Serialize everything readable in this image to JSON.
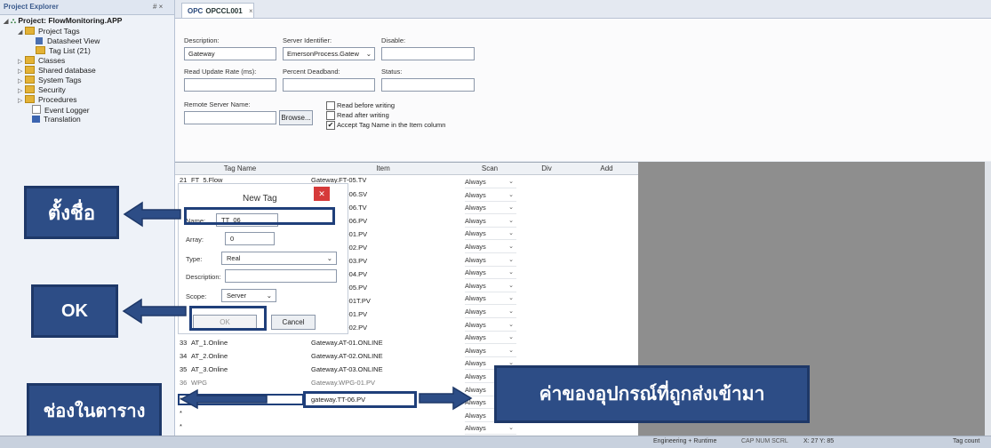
{
  "explorer": {
    "header": "Project Explorer",
    "header_controls": "# ×",
    "project": "Project: FlowMonitoring.APP",
    "items": [
      {
        "label": "Project Tags"
      },
      {
        "label": "Datasheet View"
      },
      {
        "label": "Tag List (21)"
      },
      {
        "label": "Classes"
      },
      {
        "label": "Shared database"
      },
      {
        "label": "System Tags"
      },
      {
        "label": "Security"
      },
      {
        "label": "Procedures"
      },
      {
        "label": "Event Logger"
      },
      {
        "label": "Translation"
      }
    ]
  },
  "tab": {
    "icon": "OPC",
    "label": "OPCCL001",
    "close": "×"
  },
  "props": {
    "description_label": "Description:",
    "description_value": "Gateway",
    "server_label": "Server Identifier:",
    "server_value": "EmersonProcess.Gatew",
    "disable_label": "Disable:",
    "read_rate_label": "Read Update Rate (ms):",
    "deadband_label": "Percent Deadband:",
    "status_label": "Status:",
    "remote_label": "Remote Server Name:",
    "browse_label": "Browse...",
    "read_before": "Read before writing",
    "read_after": "Read after writing",
    "accept_tag": "Accept Tag Name in the Item column"
  },
  "grid": {
    "headers": [
      "Tag Name",
      "Item",
      "Scan",
      "Div",
      "Add"
    ],
    "first_row": {
      "num": "21",
      "tag": "FT_5.Flow",
      "item": "Gateway.FT-05.TV"
    },
    "item_tail": [
      "T-06.SV",
      "T-06.TV",
      "T-06.PV",
      "T-01.PV",
      "T-02.PV",
      "T-03.PV",
      "T-04.PV",
      "T-05.PV",
      "T-01T.PV",
      "T-01.PV",
      "T-02.PV"
    ],
    "bottom_rows": [
      {
        "num": "33",
        "tag": "AT_1.Online",
        "item": "Gateway.AT-01.ONLINE"
      },
      {
        "num": "34",
        "tag": "AT_2.Online",
        "item": "Gateway.AT-02.ONLINE"
      },
      {
        "num": "35",
        "tag": "AT_3.Online",
        "item": "Gateway.AT-03.ONLINE"
      },
      {
        "num": "36",
        "tag": "WPG",
        "item": "Gateway.WPG-01.PV"
      }
    ],
    "new_item": "gateway.TT-06.PV",
    "asterisk": "*",
    "scan_value": "Always"
  },
  "dialog": {
    "title": "New Tag",
    "name_label": "Name:",
    "name_value": "TT_06",
    "array_label": "Array:",
    "array_value": "0",
    "type_label": "Type:",
    "type_value": "Real",
    "description_label": "Description:",
    "scope_label": "Scope:",
    "scope_value": "Server",
    "ok_label": "OK",
    "cancel_label": "Cancel"
  },
  "annotations": {
    "name_callout": "ตั้งชื่อ",
    "ok_callout": "OK",
    "cell_callout": "ช่องในตาราง",
    "value_callout": "ค่าของอุปกรณ์ที่ถูกส่งเข้ามา"
  },
  "status": {
    "mode": "Engineering + Runtime",
    "keys": "CAP NUM SCRL",
    "coords": "X: 27 Y: 85",
    "tag_count": "Tag count"
  },
  "colors": {
    "callout": "#2d4d86",
    "highlight": "#1f3f7a",
    "gray_area": "#8e8e8e"
  }
}
